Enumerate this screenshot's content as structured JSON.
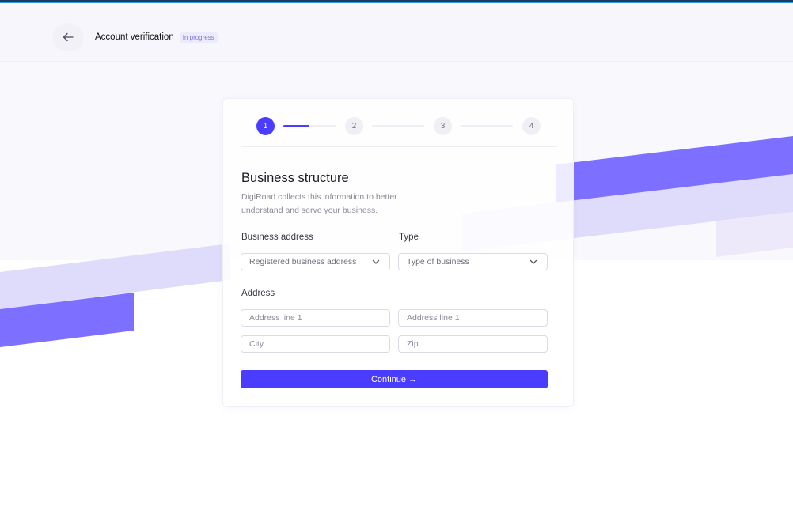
{
  "header": {
    "back_icon": "arrow-left-icon",
    "title": "Account verification",
    "badge": "In progress"
  },
  "stepper": {
    "steps": [
      "1",
      "2",
      "3",
      "4"
    ],
    "current_step": 1,
    "progress_fraction": 0.5
  },
  "form": {
    "title": "Business structure",
    "description": "DigiRoad collects this information to better understand and serve your business.",
    "business_address_label": "Business address",
    "business_address_value": "Registered business address",
    "type_label": "Type",
    "type_value": "Type of business",
    "address_label": "Address",
    "address_line_1_placeholder": "Address line 1",
    "address_line_2_placeholder": "Address line 1",
    "city_placeholder": "City",
    "zip_placeholder": "Zip",
    "continue_label": "Continue →"
  },
  "colors": {
    "accent": "#4a3dff",
    "ribbon_dark": "#7b6cff",
    "ribbon_light": "#dcd8fb",
    "background": "#f9f8fd"
  }
}
